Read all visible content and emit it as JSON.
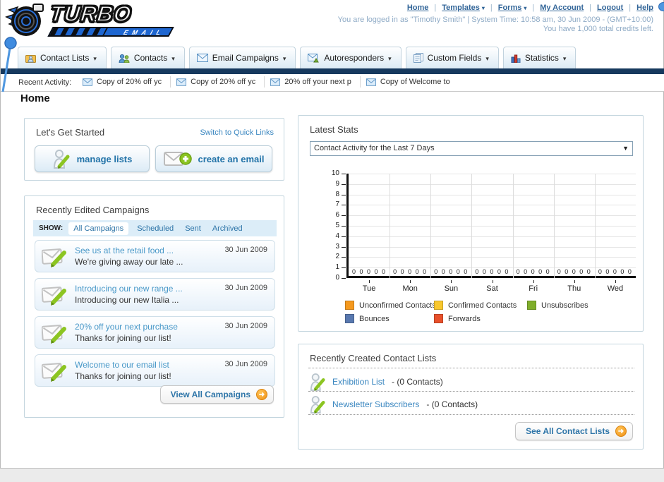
{
  "header": {
    "logo": {
      "title": "TURBO",
      "subtitle": "EMAIL"
    },
    "nav": [
      "Home",
      "Templates",
      "Forms",
      "My Account",
      "Logout",
      "Help"
    ],
    "login_line": "You are logged in as \"Timothy Smith\" | System Time: 10:58 am, 30 Jun 2009 - (GMT+10:00)",
    "credits_line": "You have 1,000 total credits left."
  },
  "tabs": [
    {
      "label": "Contact Lists",
      "icon": "contact-lists-icon"
    },
    {
      "label": "Contacts",
      "icon": "contacts-icon"
    },
    {
      "label": "Email Campaigns",
      "icon": "email-campaigns-icon"
    },
    {
      "label": "Autoresponders",
      "icon": "autoresponders-icon"
    },
    {
      "label": "Custom Fields",
      "icon": "custom-fields-icon"
    },
    {
      "label": "Statistics",
      "icon": "statistics-icon"
    }
  ],
  "recent_activity": {
    "label": "Recent Activity:",
    "items": [
      "Copy of 20% off yc",
      "Copy of 20% off yc",
      "20% off your next p",
      "Copy of Welcome to"
    ]
  },
  "page_title": "Home",
  "get_started": {
    "title": "Let's Get Started",
    "switch_link": "Switch to Quick Links",
    "manage_lists_button": "manage lists",
    "create_email_button": "create an email"
  },
  "campaigns": {
    "title": "Recently Edited Campaigns",
    "show_label": "SHOW:",
    "filters": [
      "All Campaigns",
      "Scheduled",
      "Sent",
      "Archived"
    ],
    "active_filter": "All Campaigns",
    "items": [
      {
        "title": "See us at the retail food ...",
        "subtitle": "We're giving away our late ...",
        "date": "30 Jun 2009"
      },
      {
        "title": "Introducing our new range ...",
        "subtitle": "Introducing our new Italia ...",
        "date": "30 Jun 2009"
      },
      {
        "title": "20% off your next purchase",
        "subtitle": "Thanks for joining our list!",
        "date": "30 Jun 2009"
      },
      {
        "title": "Welcome to our email list",
        "subtitle": "Thanks for joining our list!",
        "date": "30 Jun 2009"
      }
    ],
    "view_all_button": "View All Campaigns"
  },
  "stats": {
    "title": "Latest Stats",
    "period_selected": "Contact Activity for the Last 7 Days"
  },
  "chart_data": {
    "type": "bar",
    "title": "Contact Activity for the Last 7 Days",
    "categories": [
      "Tue",
      "Mon",
      "Sun",
      "Sat",
      "Fri",
      "Thu",
      "Wed"
    ],
    "series": [
      {
        "name": "Unconfirmed Contacts",
        "color": "#f5991e",
        "values": [
          0,
          0,
          0,
          0,
          0,
          0,
          0
        ]
      },
      {
        "name": "Confirmed Contacts",
        "color": "#f8c72d",
        "values": [
          0,
          0,
          0,
          0,
          0,
          0,
          0
        ]
      },
      {
        "name": "Unsubscribes",
        "color": "#7fae2a",
        "values": [
          0,
          0,
          0,
          0,
          0,
          0,
          0
        ]
      },
      {
        "name": "Bounces",
        "color": "#5878af",
        "values": [
          0,
          0,
          0,
          0,
          0,
          0,
          0
        ]
      },
      {
        "name": "Forwards",
        "color": "#e8502b",
        "values": [
          0,
          0,
          0,
          0,
          0,
          0,
          0
        ]
      }
    ],
    "ylim": [
      0,
      10
    ],
    "ytick_step": 1,
    "grid": true,
    "legend_position": "bottom",
    "data_labels": "each series shows 0 above the axis for every day"
  },
  "contact_lists": {
    "title": "Recently Created Contact Lists",
    "items": [
      {
        "name": "Exhibition List",
        "detail": "- (0 Contacts)"
      },
      {
        "name": "Newsletter Subscribers",
        "detail": "- (0 Contacts)"
      }
    ],
    "see_all_button": "See All Contact Lists"
  }
}
